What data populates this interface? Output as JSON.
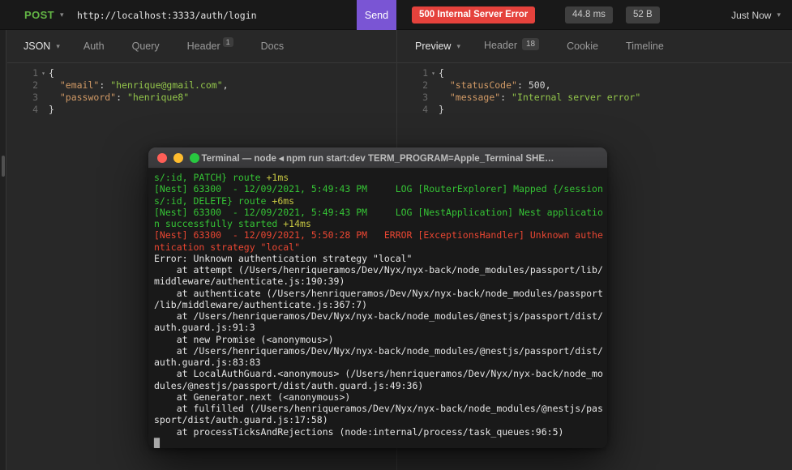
{
  "colors": {
    "method_green": "#63b545",
    "send_purple": "#7a55d4",
    "status_red": "#e5423c",
    "key_orange": "#d19a66",
    "string_green": "#93c54b",
    "terminal_green": "#35c335",
    "terminal_red": "#ea4632"
  },
  "topbar": {
    "method": "POST",
    "caret": "▾",
    "url": "http://localhost:3333/auth/login",
    "send": "Send",
    "status": "500 Internal Server Error",
    "time": "44.8 ms",
    "size": "52 B",
    "history": "Just Now"
  },
  "request_panel": {
    "body_menu": "JSON",
    "tabs": [
      {
        "label": "Auth"
      },
      {
        "label": "Query"
      },
      {
        "label": "Header",
        "badge": "1"
      },
      {
        "label": "Docs"
      }
    ],
    "lines": [
      {
        "num": "1",
        "fold": true,
        "segs": [
          {
            "t": "{",
            "c": "punct"
          }
        ]
      },
      {
        "num": "2",
        "segs": [
          {
            "t": "  ",
            "c": "punct"
          },
          {
            "t": "\"email\"",
            "c": "key"
          },
          {
            "t": ": ",
            "c": "punct"
          },
          {
            "t": "\"henrique@gmail.com\"",
            "c": "str"
          },
          {
            "t": ",",
            "c": "punct"
          }
        ]
      },
      {
        "num": "3",
        "segs": [
          {
            "t": "  ",
            "c": "punct"
          },
          {
            "t": "\"password\"",
            "c": "key"
          },
          {
            "t": ": ",
            "c": "punct"
          },
          {
            "t": "\"henrique8\"",
            "c": "str"
          }
        ]
      },
      {
        "num": "4",
        "segs": [
          {
            "t": "}",
            "c": "punct"
          }
        ]
      }
    ]
  },
  "response_panel": {
    "view_menu": "Preview",
    "tabs": [
      {
        "label": "Header",
        "badge": "18"
      },
      {
        "label": "Cookie"
      },
      {
        "label": "Timeline"
      }
    ],
    "lines": [
      {
        "num": "1",
        "fold": true,
        "segs": [
          {
            "t": "{",
            "c": "punct"
          }
        ]
      },
      {
        "num": "2",
        "segs": [
          {
            "t": "  ",
            "c": "punct"
          },
          {
            "t": "\"statusCode\"",
            "c": "key"
          },
          {
            "t": ": ",
            "c": "punct"
          },
          {
            "t": "500",
            "c": "num"
          },
          {
            "t": ",",
            "c": "punct"
          }
        ]
      },
      {
        "num": "3",
        "segs": [
          {
            "t": "  ",
            "c": "punct"
          },
          {
            "t": "\"message\"",
            "c": "key"
          },
          {
            "t": ": ",
            "c": "punct"
          },
          {
            "t": "\"Internal server error\"",
            "c": "str"
          }
        ]
      },
      {
        "num": "4",
        "segs": [
          {
            "t": "}",
            "c": "punct"
          }
        ]
      }
    ]
  },
  "terminal": {
    "title": "Terminal — node ◂ npm run start:dev TERM_PROGRAM=Apple_Terminal SHE…",
    "lines": [
      {
        "segs": [
          {
            "t": "s/:id, PATCH} route ",
            "c": "tgreen"
          },
          {
            "t": "+1ms",
            "c": "tyellow"
          }
        ]
      },
      {
        "segs": [
          {
            "t": "[Nest] 63300  - 12/09/2021, 5:49:43 PM     LOG [RouterExplorer] Mapped {/session",
            "c": "tgreen"
          }
        ]
      },
      {
        "segs": [
          {
            "t": "s/:id, DELETE} route ",
            "c": "tgreen"
          },
          {
            "t": "+6ms",
            "c": "tyellow"
          }
        ]
      },
      {
        "segs": [
          {
            "t": "[Nest] 63300  - 12/09/2021, 5:49:43 PM     LOG [NestApplication] Nest applicatio",
            "c": "tgreen"
          }
        ]
      },
      {
        "segs": [
          {
            "t": "n successfully started ",
            "c": "tgreen"
          },
          {
            "t": "+14ms",
            "c": "tyellow"
          }
        ]
      },
      {
        "segs": [
          {
            "t": "[Nest] 63300  - 12/09/2021, 5:50:28 PM   ERROR [ExceptionsHandler] Unknown authe",
            "c": "tred"
          }
        ]
      },
      {
        "segs": [
          {
            "t": "ntication strategy \"local\"",
            "c": "tred"
          }
        ]
      },
      {
        "segs": [
          {
            "t": "Error: Unknown authentication strategy \"local\"",
            "c": "twhite"
          }
        ]
      },
      {
        "segs": [
          {
            "t": "    at attempt (/Users/henriqueramos/Dev/Nyx/nyx-back/node_modules/passport/lib/",
            "c": "twhite"
          }
        ]
      },
      {
        "segs": [
          {
            "t": "middleware/authenticate.js:190:39)",
            "c": "twhite"
          }
        ]
      },
      {
        "segs": [
          {
            "t": "    at authenticate (/Users/henriqueramos/Dev/Nyx/nyx-back/node_modules/passport",
            "c": "twhite"
          }
        ]
      },
      {
        "segs": [
          {
            "t": "/lib/middleware/authenticate.js:367:7)",
            "c": "twhite"
          }
        ]
      },
      {
        "segs": [
          {
            "t": "    at /Users/henriqueramos/Dev/Nyx/nyx-back/node_modules/@nestjs/passport/dist/",
            "c": "twhite"
          }
        ]
      },
      {
        "segs": [
          {
            "t": "auth.guard.js:91:3",
            "c": "twhite"
          }
        ]
      },
      {
        "segs": [
          {
            "t": "    at new Promise (<anonymous>)",
            "c": "twhite"
          }
        ]
      },
      {
        "segs": [
          {
            "t": "    at /Users/henriqueramos/Dev/Nyx/nyx-back/node_modules/@nestjs/passport/dist/",
            "c": "twhite"
          }
        ]
      },
      {
        "segs": [
          {
            "t": "auth.guard.js:83:83",
            "c": "twhite"
          }
        ]
      },
      {
        "segs": [
          {
            "t": "    at LocalAuthGuard.<anonymous> (/Users/henriqueramos/Dev/Nyx/nyx-back/node_mo",
            "c": "twhite"
          }
        ]
      },
      {
        "segs": [
          {
            "t": "dules/@nestjs/passport/dist/auth.guard.js:49:36)",
            "c": "twhite"
          }
        ]
      },
      {
        "segs": [
          {
            "t": "    at Generator.next (<anonymous>)",
            "c": "twhite"
          }
        ]
      },
      {
        "segs": [
          {
            "t": "    at fulfilled (/Users/henriqueramos/Dev/Nyx/nyx-back/node_modules/@nestjs/pas",
            "c": "twhite"
          }
        ]
      },
      {
        "segs": [
          {
            "t": "sport/dist/auth.guard.js:17:58)",
            "c": "twhite"
          }
        ]
      },
      {
        "segs": [
          {
            "t": "    at processTicksAndRejections (node:internal/process/task_queues:96:5)",
            "c": "twhite"
          }
        ]
      },
      {
        "segs": [
          {
            "t": "█",
            "c": "tcursor"
          }
        ]
      }
    ]
  }
}
